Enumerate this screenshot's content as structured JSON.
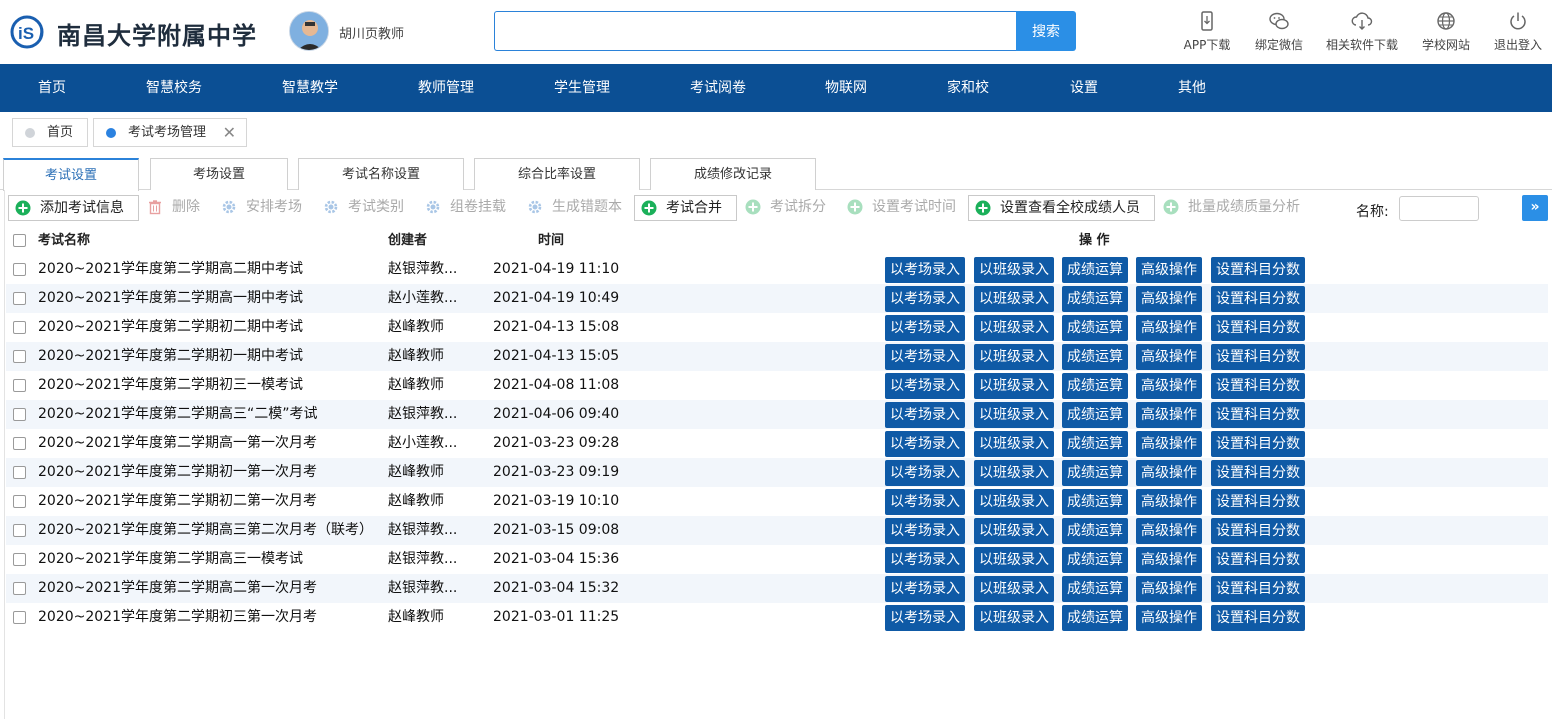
{
  "header": {
    "school_name": "南昌大学附属中学",
    "teacher_name": "胡川页教师",
    "search_placeholder": "",
    "search_button": "搜索",
    "links": [
      {
        "label": "APP下载",
        "icon": "phone-icon"
      },
      {
        "label": "绑定微信",
        "icon": "wechat-icon"
      },
      {
        "label": "相关软件下载",
        "icon": "cloud-download-icon"
      },
      {
        "label": "学校网站",
        "icon": "globe-icon"
      },
      {
        "label": "退出登入",
        "icon": "power-icon"
      }
    ]
  },
  "nav": {
    "items": [
      "首页",
      "智慧校务",
      "智慧教学",
      "教师管理",
      "学生管理",
      "考试阅卷",
      "物联网",
      "家和校",
      "设置",
      "其他"
    ]
  },
  "breadcrumbs": {
    "items": [
      {
        "label": "首页"
      },
      {
        "label": "考试考场管理"
      }
    ]
  },
  "subtabs": {
    "items": [
      "考试设置",
      "考场设置",
      "考试名称设置",
      "综合比率设置",
      "成绩修改记录"
    ],
    "active": "考试设置"
  },
  "toolbar": {
    "buttons": [
      {
        "label": "添加考试信息",
        "enabled": true,
        "icon": "add-circle-icon"
      },
      {
        "label": "删除",
        "enabled": false,
        "icon": "trash-icon"
      },
      {
        "label": "安排考场",
        "enabled": false,
        "icon": "gear-icon"
      },
      {
        "label": "考试类别",
        "enabled": false,
        "icon": "gear-icon"
      },
      {
        "label": "组卷挂载",
        "enabled": false,
        "icon": "gear-icon"
      },
      {
        "label": "生成错题本",
        "enabled": false,
        "icon": "gear-icon"
      },
      {
        "label": "考试合并",
        "enabled": true,
        "icon": "add-circle-icon"
      },
      {
        "label": "考试拆分",
        "enabled": false,
        "icon": "add-circle-icon"
      },
      {
        "label": "设置考试时间",
        "enabled": false,
        "icon": "add-circle-icon"
      },
      {
        "label": "设置查看全校成绩人员",
        "enabled": true,
        "icon": "add-circle-icon"
      },
      {
        "label": "批量成绩质量分析",
        "enabled": false,
        "icon": "add-circle-icon"
      }
    ],
    "name_label": "名称:",
    "name_value": "",
    "expand_icon": "double-chevron-right-icon"
  },
  "table": {
    "headers": {
      "name": "考试名称",
      "creator": "创建者",
      "time": "时间",
      "ops": "操 作"
    },
    "op_buttons": [
      "以考场录入",
      "以班级录入",
      "成绩运算",
      "高级操作",
      "设置科目分数"
    ],
    "rows": [
      {
        "name": "2020~2021学年度第二学期高二期中考试",
        "creator": "赵银萍教...",
        "time": "2021-04-19 11:10"
      },
      {
        "name": "2020~2021学年度第二学期高一期中考试",
        "creator": "赵小莲教...",
        "time": "2021-04-19 10:49"
      },
      {
        "name": "2020~2021学年度第二学期初二期中考试",
        "creator": "赵峰教师",
        "time": "2021-04-13 15:08"
      },
      {
        "name": "2020~2021学年度第二学期初一期中考试",
        "creator": "赵峰教师",
        "time": "2021-04-13 15:05"
      },
      {
        "name": "2020~2021学年度第二学期初三一模考试",
        "creator": "赵峰教师",
        "time": "2021-04-08 11:08"
      },
      {
        "name": "2020~2021学年度第二学期高三“二模”考试",
        "creator": "赵银萍教...",
        "time": "2021-04-06 09:40"
      },
      {
        "name": "2020~2021学年度第二学期高一第一次月考",
        "creator": "赵小莲教...",
        "time": "2021-03-23 09:28"
      },
      {
        "name": "2020~2021学年度第二学期初一第一次月考",
        "creator": "赵峰教师",
        "time": "2021-03-23 09:19"
      },
      {
        "name": "2020~2021学年度第二学期初二第一次月考",
        "creator": "赵峰教师",
        "time": "2021-03-19 10:10"
      },
      {
        "name": "2020~2021学年度第二学期高三第二次月考（联考）",
        "creator": "赵银萍教...",
        "time": "2021-03-15 09:08"
      },
      {
        "name": "2020~2021学年度第二学期高三一模考试",
        "creator": "赵银萍教...",
        "time": "2021-03-04 15:36"
      },
      {
        "name": "2020~2021学年度第二学期高二第一次月考",
        "creator": "赵银萍教...",
        "time": "2021-03-04 15:32"
      },
      {
        "name": "2020~2021学年度第二学期初三第一次月考",
        "creator": "赵峰教师",
        "time": "2021-03-01 11:25"
      }
    ]
  },
  "colors": {
    "nav_bg": "#0b4f94",
    "op_button": "#0f5aa6",
    "accent": "#2b8fe6",
    "row_alt": "#f2f6fb"
  }
}
